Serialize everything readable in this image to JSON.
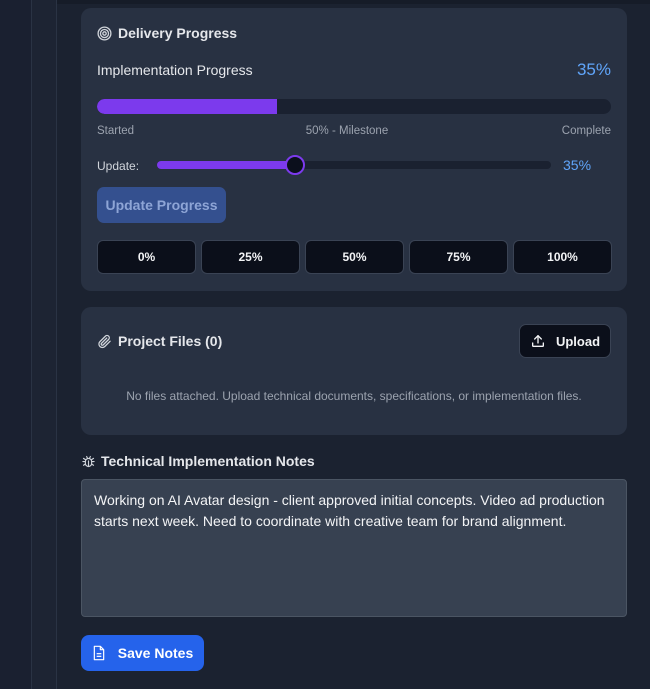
{
  "delivery": {
    "title": "Delivery Progress",
    "impl_label": "Implementation Progress",
    "impl_percent": "35%",
    "progress_value": 0.35,
    "scale_start": "Started",
    "scale_mid": "50% - Milestone",
    "scale_end": "Complete",
    "update_label": "Update:",
    "update_percent": "35%",
    "slider_value": 0.35,
    "update_button": "Update Progress",
    "quick": [
      "0%",
      "25%",
      "50%",
      "75%",
      "100%"
    ]
  },
  "files": {
    "title": "Project Files (0)",
    "upload_button": "Upload",
    "empty_message": "No files attached. Upload technical documents, specifications, or implementation files."
  },
  "notes": {
    "title": "Technical Implementation Notes",
    "text": "Working on AI Avatar design - client approved initial concepts. Video ad production starts next week. Need to coordinate with creative team for brand alignment.",
    "save_button": "Save Notes"
  },
  "colors": {
    "accent_purple": "#7c3aed",
    "accent_blue": "#60a5fa",
    "primary_button": "#2563eb",
    "card_bg": "#283142"
  },
  "icons": {
    "delivery": "target-icon",
    "files": "paperclip-icon",
    "upload": "upload-icon",
    "notes": "bug-icon",
    "save": "document-icon"
  }
}
